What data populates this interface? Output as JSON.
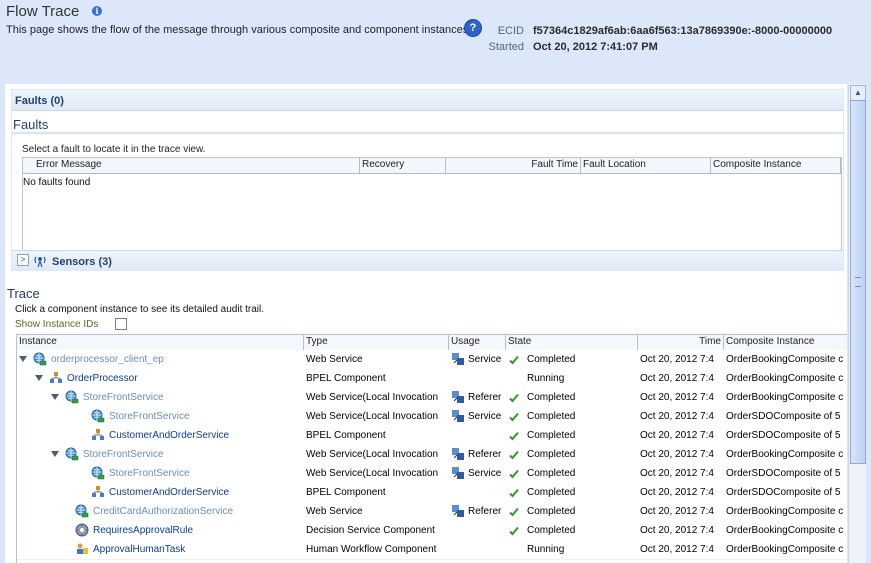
{
  "header": {
    "title": "Flow Trace",
    "description": "This page shows the flow of the message through various composite and component instances.",
    "ecid_label": "ECID",
    "ecid_value": "f57364c1829af6ab:6aa6f563:13a7869390e:-8000-00000000",
    "started_label": "Started",
    "started_value": "Oct 20, 2012 7:41:07 PM"
  },
  "faults": {
    "panel_label": "Faults (0)",
    "section_title": "Faults",
    "hint": "Select a fault to locate it in the trace view.",
    "columns": [
      "Error Message",
      "Recovery",
      "Fault Time",
      "Fault Location",
      "Composite Instance"
    ],
    "empty_text": "No faults found"
  },
  "sensors": {
    "label": "Sensors (3)"
  },
  "trace": {
    "title": "Trace",
    "hint": "Click a component instance to see its detailed audit trail.",
    "show_ids_label": "Show Instance IDs",
    "columns": [
      "Instance",
      "Type",
      "Usage",
      "State",
      "Time",
      "Composite Instance"
    ],
    "rows": [
      {
        "instance": "orderprocessor_client_ep",
        "type": "Web Service",
        "usage": "Service",
        "state": "Completed",
        "time": "Oct 20, 2012 7:4",
        "composite": "OrderBookingComposite c"
      },
      {
        "instance": "OrderProcessor",
        "type": "BPEL Component",
        "usage": "",
        "state": "Running",
        "time": "Oct 20, 2012 7:4",
        "composite": "OrderBookingComposite c"
      },
      {
        "instance": "StoreFrontService",
        "type": "Web Service(Local Invocation",
        "usage": "Referer",
        "state": "Completed",
        "time": "Oct 20, 2012 7:4",
        "composite": "OrderBookingComposite c"
      },
      {
        "instance": "StoreFrontService",
        "type": "Web Service(Local Invocation",
        "usage": "Service",
        "state": "Completed",
        "time": "Oct 20, 2012 7:4",
        "composite": "OrderSDOComposite of 5"
      },
      {
        "instance": "CustomerAndOrderService",
        "type": "BPEL Component",
        "usage": "",
        "state": "Completed",
        "time": "Oct 20, 2012 7:4",
        "composite": "OrderSDOComposite of 5"
      },
      {
        "instance": "StoreFrontService",
        "type": "Web Service(Local Invocation",
        "usage": "Referer",
        "state": "Completed",
        "time": "Oct 20, 2012 7:4",
        "composite": "OrderBookingComposite c"
      },
      {
        "instance": "StoreFrontService",
        "type": "Web Service(Local Invocation",
        "usage": "Service",
        "state": "Completed",
        "time": "Oct 20, 2012 7:4",
        "composite": "OrderSDOComposite of 5"
      },
      {
        "instance": "CustomerAndOrderService",
        "type": "BPEL Component",
        "usage": "",
        "state": "Completed",
        "time": "Oct 20, 2012 7:4",
        "composite": "OrderSDOComposite of 5"
      },
      {
        "instance": "CreditCardAuthorizationService",
        "type": "Web Service",
        "usage": "Referer",
        "state": "Completed",
        "time": "Oct 20, 2012 7:4",
        "composite": "OrderBookingComposite c"
      },
      {
        "instance": "RequiresApprovalRule",
        "type": "Decision Service Component",
        "usage": "",
        "state": "Completed",
        "time": "Oct 20, 2012 7:4",
        "composite": "OrderBookingComposite c"
      },
      {
        "instance": "ApprovalHumanTask",
        "type": "Human Workflow Component",
        "usage": "",
        "state": "Running",
        "time": "Oct 20, 2012 7:4",
        "composite": "OrderBookingComposite c"
      }
    ]
  },
  "colors": {
    "header_bg": "#dce8fa",
    "link": "#0f3b8d",
    "link_alt": "#6a8db7",
    "check": "#2f9a28"
  }
}
